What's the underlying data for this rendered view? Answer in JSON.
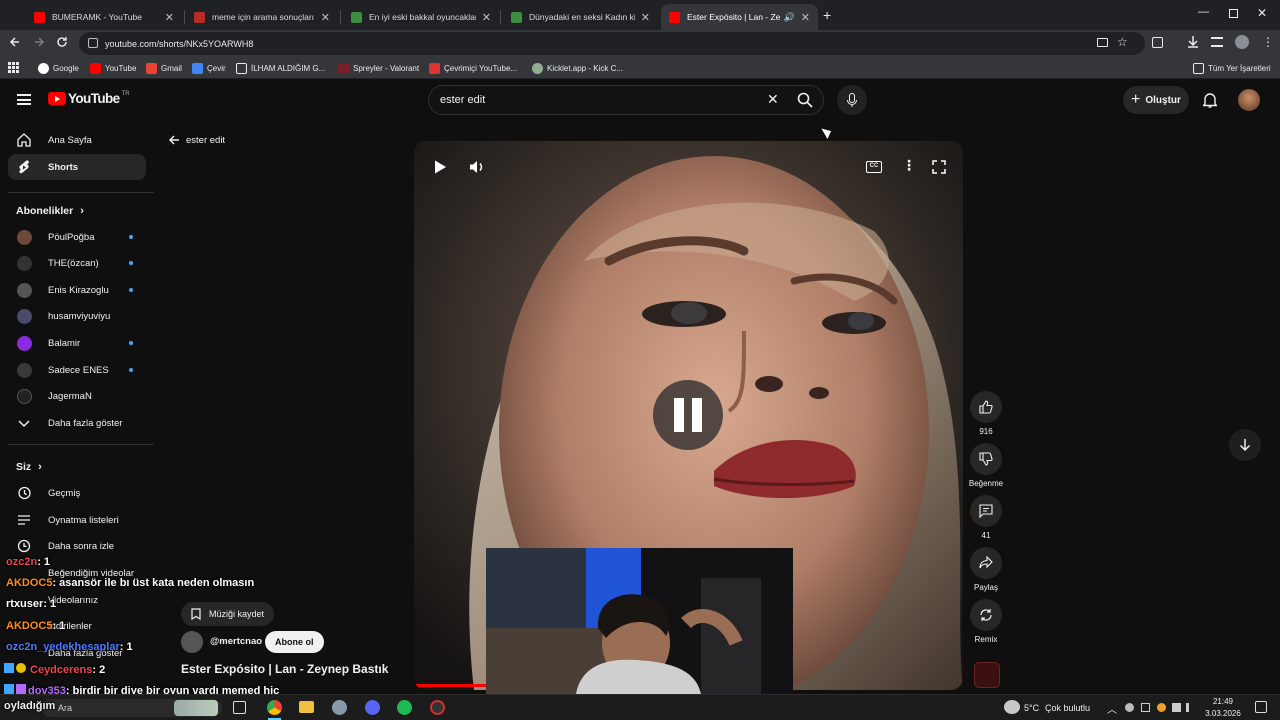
{
  "browser": {
    "tabs": [
      {
        "title": "BUMERAMK - YouTube",
        "icon": "youtube-icon",
        "active": false
      },
      {
        "title": "meme için arama sonuçları - Q",
        "icon": "site-icon",
        "active": false
      },
      {
        "title": "En iyi eski bakkal oyuncakları -",
        "icon": "site-icon",
        "active": false
      },
      {
        "title": "Dünyadaki en seksi Kadın kim -",
        "icon": "site-icon",
        "active": false
      },
      {
        "title": "Ester Expósito | Lan - Zeyne",
        "icon": "youtube-icon",
        "active": true
      }
    ],
    "url": "youtube.com/shorts/NKx5YOARWH8",
    "bookmarks": [
      {
        "label": "Google"
      },
      {
        "label": "YouTube"
      },
      {
        "label": "Gmail"
      },
      {
        "label": "Çevir"
      },
      {
        "label": "İLHAM ALDIĞIM G..."
      },
      {
        "label": "Spreyler - Valorant"
      },
      {
        "label": "Çevrimiçi YouTube..."
      },
      {
        "label": "Kicklet.app - Kick C..."
      }
    ],
    "all_bookmarks": "Tüm Yer İşaretleri"
  },
  "youtube": {
    "logo_text": "YouTube",
    "logo_country": "TR",
    "search_value": "ester edit",
    "create_label": "Oluştur",
    "back_label": "ester edit",
    "sidebar": {
      "main": [
        {
          "label": "Ana Sayfa",
          "icon": "home-icon"
        },
        {
          "label": "Shorts",
          "icon": "shorts-icon"
        }
      ],
      "subs_heading": "Abonelikler",
      "subs": [
        {
          "label": "PöulPoğba",
          "new": true,
          "color": "#6b4a3a"
        },
        {
          "label": "THE(özcan)",
          "new": true,
          "color": "#333"
        },
        {
          "label": "Enis Kirazoglu",
          "new": true,
          "color": "#555"
        },
        {
          "label": "husamviyuviyu",
          "new": false,
          "color": "#4a4a6a"
        },
        {
          "label": "Balamir",
          "new": true,
          "color": "#8a2be2"
        },
        {
          "label": "Sadece ENES",
          "new": true,
          "color": "#3a3a3a"
        },
        {
          "label": "JagermaN",
          "new": false,
          "color": "#222"
        }
      ],
      "more_subs": "Daha fazla göster",
      "you_heading": "Siz",
      "you_items": [
        {
          "label": "Geçmiş",
          "icon": "history-icon"
        },
        {
          "label": "Oynatma listeleri",
          "icon": "playlist-icon"
        },
        {
          "label": "Daha sonra izle",
          "icon": "clock-icon"
        },
        {
          "label": "Beğendiğim videolar",
          "icon": "like-icon"
        },
        {
          "label": "Videolarınız",
          "icon": "video-icon"
        },
        {
          "label": "İndirilenler",
          "icon": "download-icon"
        },
        {
          "label": "Daha fazla göster",
          "icon": "chevron-down-icon"
        }
      ]
    },
    "short": {
      "save_music": "Müziği kaydet",
      "channel": "@mertcnao",
      "subscribe": "Abone ol",
      "title": "Ester Expósito | Lan - Zeynep Bastık"
    },
    "actions": {
      "likes": "916",
      "dislike_label": "Beğenme",
      "comments": "41",
      "share_label": "Paylaş",
      "remix_label": "Remix"
    }
  },
  "chat": [
    {
      "user": "ozc2n",
      "text": ": 1",
      "color": "#e8474f"
    },
    {
      "user": "AKDOC5",
      "text": ": asansör ile bı üst kata neden olmasın",
      "color": "#ff8c1a"
    },
    {
      "user": "rtxuser",
      "text": ": 1",
      "color": "#ffffff"
    },
    {
      "user": "AKDOC5",
      "text": ": 1",
      "color": "#ff8c1a"
    },
    {
      "user": "ozc2n_yedekhesaplar",
      "text": ": 1",
      "color": "#4d79ff"
    },
    {
      "user": "Ceydcerens",
      "text": ": 2",
      "color": "#e8474f"
    },
    {
      "user": "dov353",
      "text": ": birdir bir diye bir oyun vardı memed hiç",
      "color": "#b36bff"
    },
    {
      "user": "oyladığım",
      "text": "",
      "color": "#ffffff"
    }
  ],
  "taskbar": {
    "search_placeholder": "Ara",
    "weather": "5°C",
    "weather_text": "Çok bulutlu",
    "time": "21:49",
    "date": "3.03.2026"
  }
}
